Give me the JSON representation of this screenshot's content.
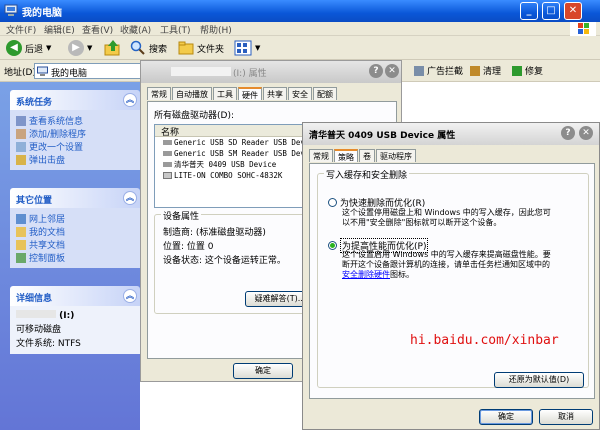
{
  "window": {
    "title": "我的电脑",
    "minimize": "_",
    "maximize": "□",
    "close": "✕"
  },
  "menu": [
    "文件(F)",
    "编辑(E)",
    "查看(V)",
    "收藏(A)",
    "工具(T)",
    "帮助(H)"
  ],
  "toolbar": {
    "back": "后退",
    "search": "搜索",
    "folders": "文件夹"
  },
  "address": {
    "label": "地址(D)",
    "value": "我的电脑"
  },
  "right_toolbar": {
    "ad_block": "广告拦截",
    "clean": "清理",
    "repair": "修复"
  },
  "left_pane": {
    "system_tasks": {
      "title": "系统任务",
      "items": [
        "查看系统信息",
        "添加/删除程序",
        "更改一个设置",
        "弹出击盘"
      ]
    },
    "other_places": {
      "title": "其它位置",
      "items": [
        "网上邻居",
        "我的文档",
        "共享文档",
        "控制面板"
      ]
    },
    "details": {
      "title": "详细信息",
      "drive_name": "(I:)",
      "drive_type": "可移动磁盘",
      "fs": "文件系统: NTFS"
    }
  },
  "disk_dialog": {
    "title": "(I:) 属性",
    "tabs": [
      "常规",
      "自动播放",
      "工具",
      "硬件",
      "共享",
      "安全",
      "配额"
    ],
    "active_tab": "硬件",
    "list_label": "所有磁盘驱动器(D):",
    "column": "名称",
    "items": [
      "Generic USB SD Reader USB Devi",
      "Generic USB SM Reader USB Devi",
      "清华普天 0409 USB Device",
      "LITE-ON COMBO SOHC-4832K"
    ],
    "props_title": "设备属性",
    "manufacturer": "制造商: (标准磁盘驱动器)",
    "location": "位置: 位置 0",
    "status": "设备状态: 这个设备运转正常。",
    "troubleshoot": "疑难解答(T)...",
    "ok": "确定"
  },
  "usb_dialog": {
    "title": "清华普天 0409 USB Device 属性",
    "tabs": [
      "常规",
      "策略",
      "卷",
      "驱动程序"
    ],
    "active_tab": "策略",
    "group_title": "写入缓存和安全删除",
    "opt1_label": "为快速删除而优化(R)",
    "opt1_desc": [
      "这个设置停用磁盘上和 Windows 中的写入缓存，因此您可",
      "以不用\"安全删除\"图标就可以断开这个设备。"
    ],
    "opt2_label": "为提高性能而优化(P)",
    "opt2_desc": [
      "这个设置启用 Windows 中的写入缓存来提高磁盘性能。要",
      "断开这个设备跟计算机的连接，请单击任务栏通知区域中的"
    ],
    "opt2_link": "安全删除硬件",
    "opt2_tail": "图标。",
    "restore": "还原为默认值(D)",
    "ok": "确定",
    "cancel": "取消"
  },
  "watermark": "hi.baidu.com/xinbar"
}
